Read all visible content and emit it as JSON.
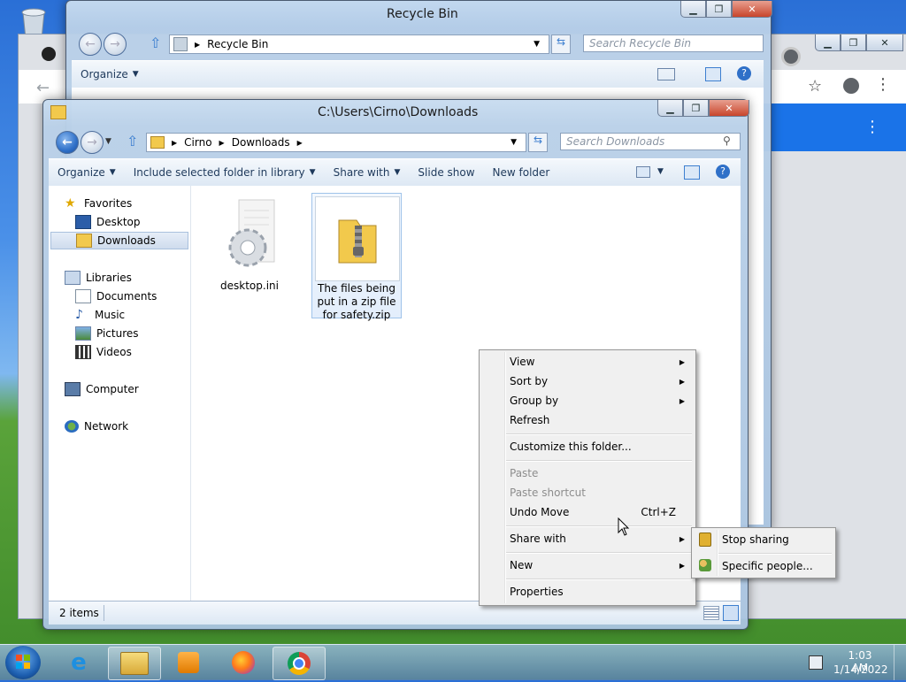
{
  "recycle_window": {
    "title": "Recycle Bin",
    "address": [
      "Recycle Bin"
    ],
    "search_placeholder": "Search Recycle Bin",
    "toolbar": {
      "organize": "Organize"
    }
  },
  "downloads_window": {
    "title": "C:\\Users\\Cirno\\Downloads",
    "address": [
      "Cirno",
      "Downloads"
    ],
    "search_placeholder": "Search Downloads",
    "toolbar": {
      "organize": "Organize",
      "include": "Include selected folder in library",
      "share_with": "Share with",
      "slide_show": "Slide show",
      "new_folder": "New folder"
    },
    "nav": {
      "favorites": "Favorites",
      "desktop": "Desktop",
      "downloads": "Downloads",
      "libraries": "Libraries",
      "documents": "Documents",
      "music": "Music",
      "pictures": "Pictures",
      "videos": "Videos",
      "computer": "Computer",
      "network": "Network"
    },
    "files": [
      {
        "name": "desktop.ini",
        "icon": "settings-file-icon"
      },
      {
        "name": "The files being put in a zip file for safety.zip",
        "icon": "zip-folder-icon"
      }
    ],
    "status": "2 items"
  },
  "context_menu": {
    "view": "View",
    "sort_by": "Sort by",
    "group_by": "Group by",
    "refresh": "Refresh",
    "customize": "Customize this folder...",
    "paste": "Paste",
    "paste_shortcut": "Paste shortcut",
    "undo_move": "Undo Move",
    "undo_shortcut": "Ctrl+Z",
    "share_with": "Share with",
    "new": "New",
    "properties": "Properties"
  },
  "submenu": {
    "stop_sharing": "Stop sharing",
    "specific_people": "Specific people..."
  },
  "taskbar": {
    "time": "1:03 AM",
    "date": "1/14/2022"
  }
}
